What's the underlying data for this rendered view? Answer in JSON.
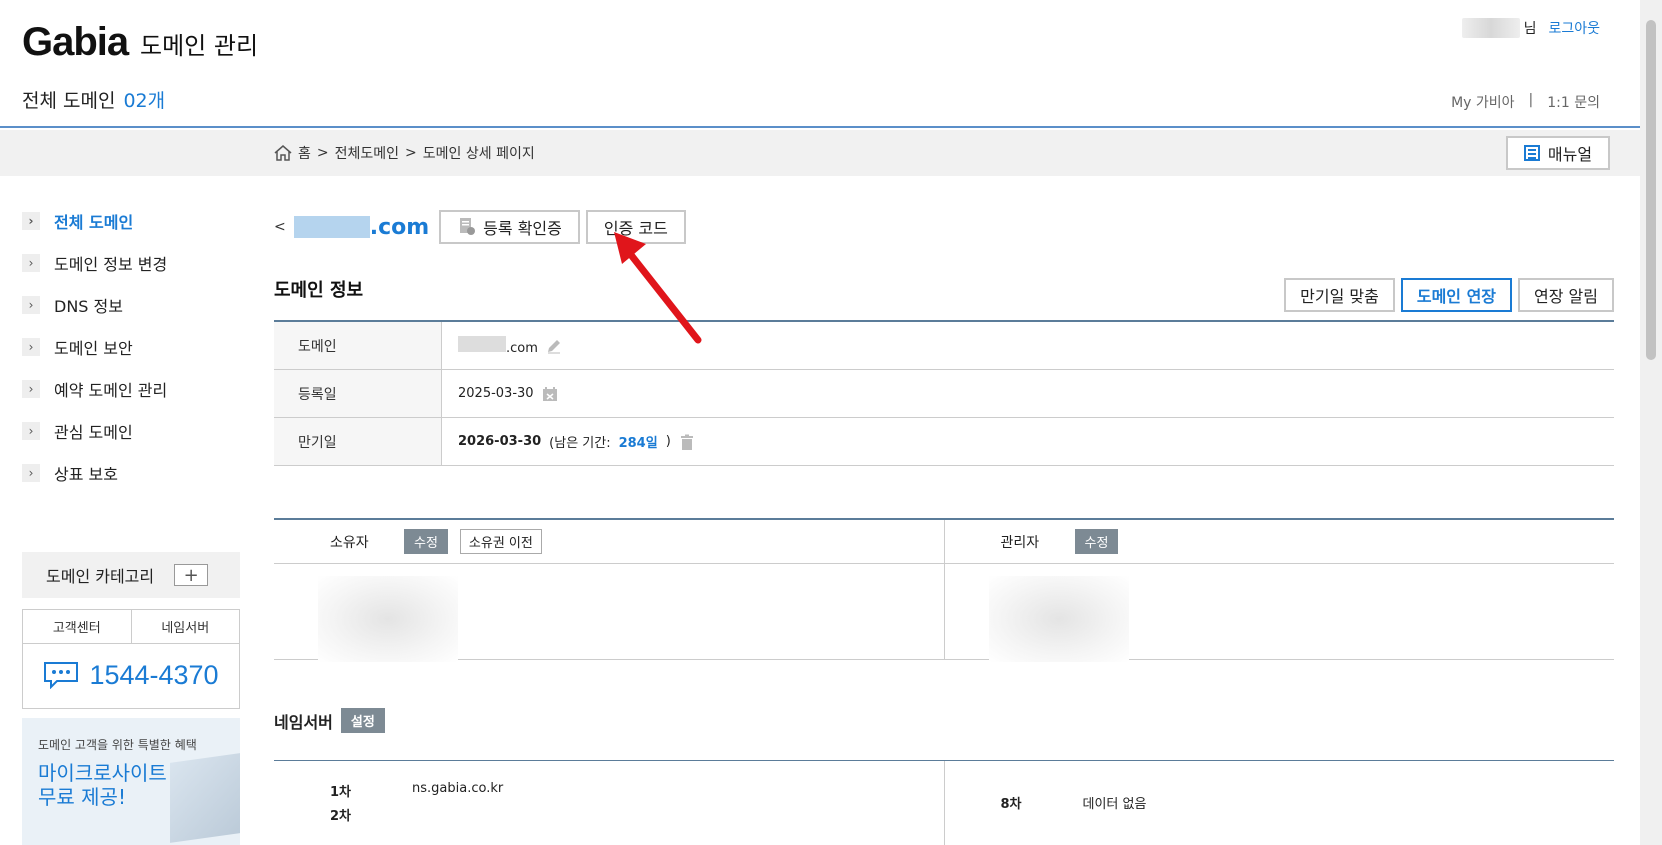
{
  "header": {
    "logo": "Gabia",
    "title": "도메인 관리",
    "total_label": "전체 도메인",
    "total_count": "02개",
    "user_suffix": "님",
    "logout": "로그아웃",
    "my_gabia": "My 가비아",
    "separator": "|",
    "inquiry": "1:1 문의"
  },
  "breadcrumb": {
    "home": "홈",
    "sep": ">",
    "level1": "전체도메인",
    "level2": "도메인 상세 페이지",
    "manual": "매뉴얼"
  },
  "sidebar": {
    "items": [
      {
        "label": "전체 도메인"
      },
      {
        "label": "도메인 정보 변경"
      },
      {
        "label": "DNS 정보"
      },
      {
        "label": "도메인 보안"
      },
      {
        "label": "예약 도메인 관리"
      },
      {
        "label": "관심 도메인"
      },
      {
        "label": "상표 보호"
      }
    ],
    "category_label": "도메인 카테고리",
    "category_add": "+",
    "support_tab1": "고객센터",
    "support_tab2": "네임서버",
    "phone": "1544-4370",
    "promo_sub": "도메인 고객을 위한 특별한 혜택",
    "promo_title": "마이크로사이트 무료 제공!"
  },
  "main": {
    "back": "<",
    "domain_tld": ".com",
    "reg_cert": "등록 확인증",
    "auth_code": "인증 코드",
    "section_title": "도메인 정보",
    "btn_align": "만기일 맞춤",
    "btn_renew": "도메인 연장",
    "btn_notify": "연장 알림",
    "rows": {
      "domain_label": "도메인",
      "domain_value": ".com",
      "reg_label": "등록일",
      "reg_value": "2025-03-30",
      "exp_label": "만기일",
      "exp_value": "2026-03-30",
      "exp_remaining_prefix": "(남은 기간:",
      "exp_remaining": "284일",
      "exp_remaining_suffix": ")"
    },
    "owner_label": "소유자",
    "owner_edit": "수정",
    "owner_transfer": "소유권 이전",
    "admin_label": "관리자",
    "admin_edit": "수정",
    "ns_title": "네임서버",
    "ns_setting": "설정",
    "ns_1_ord": "1차",
    "ns_1_val": "ns.gabia.co.kr",
    "ns_2_ord": "2차",
    "ns_8_ord": "8차",
    "ns_8_val": "데이터 없음"
  },
  "colors": {
    "accent": "#1a7bd4",
    "header_line": "#5b8fc9",
    "annotation_arrow": "#e0151b"
  }
}
